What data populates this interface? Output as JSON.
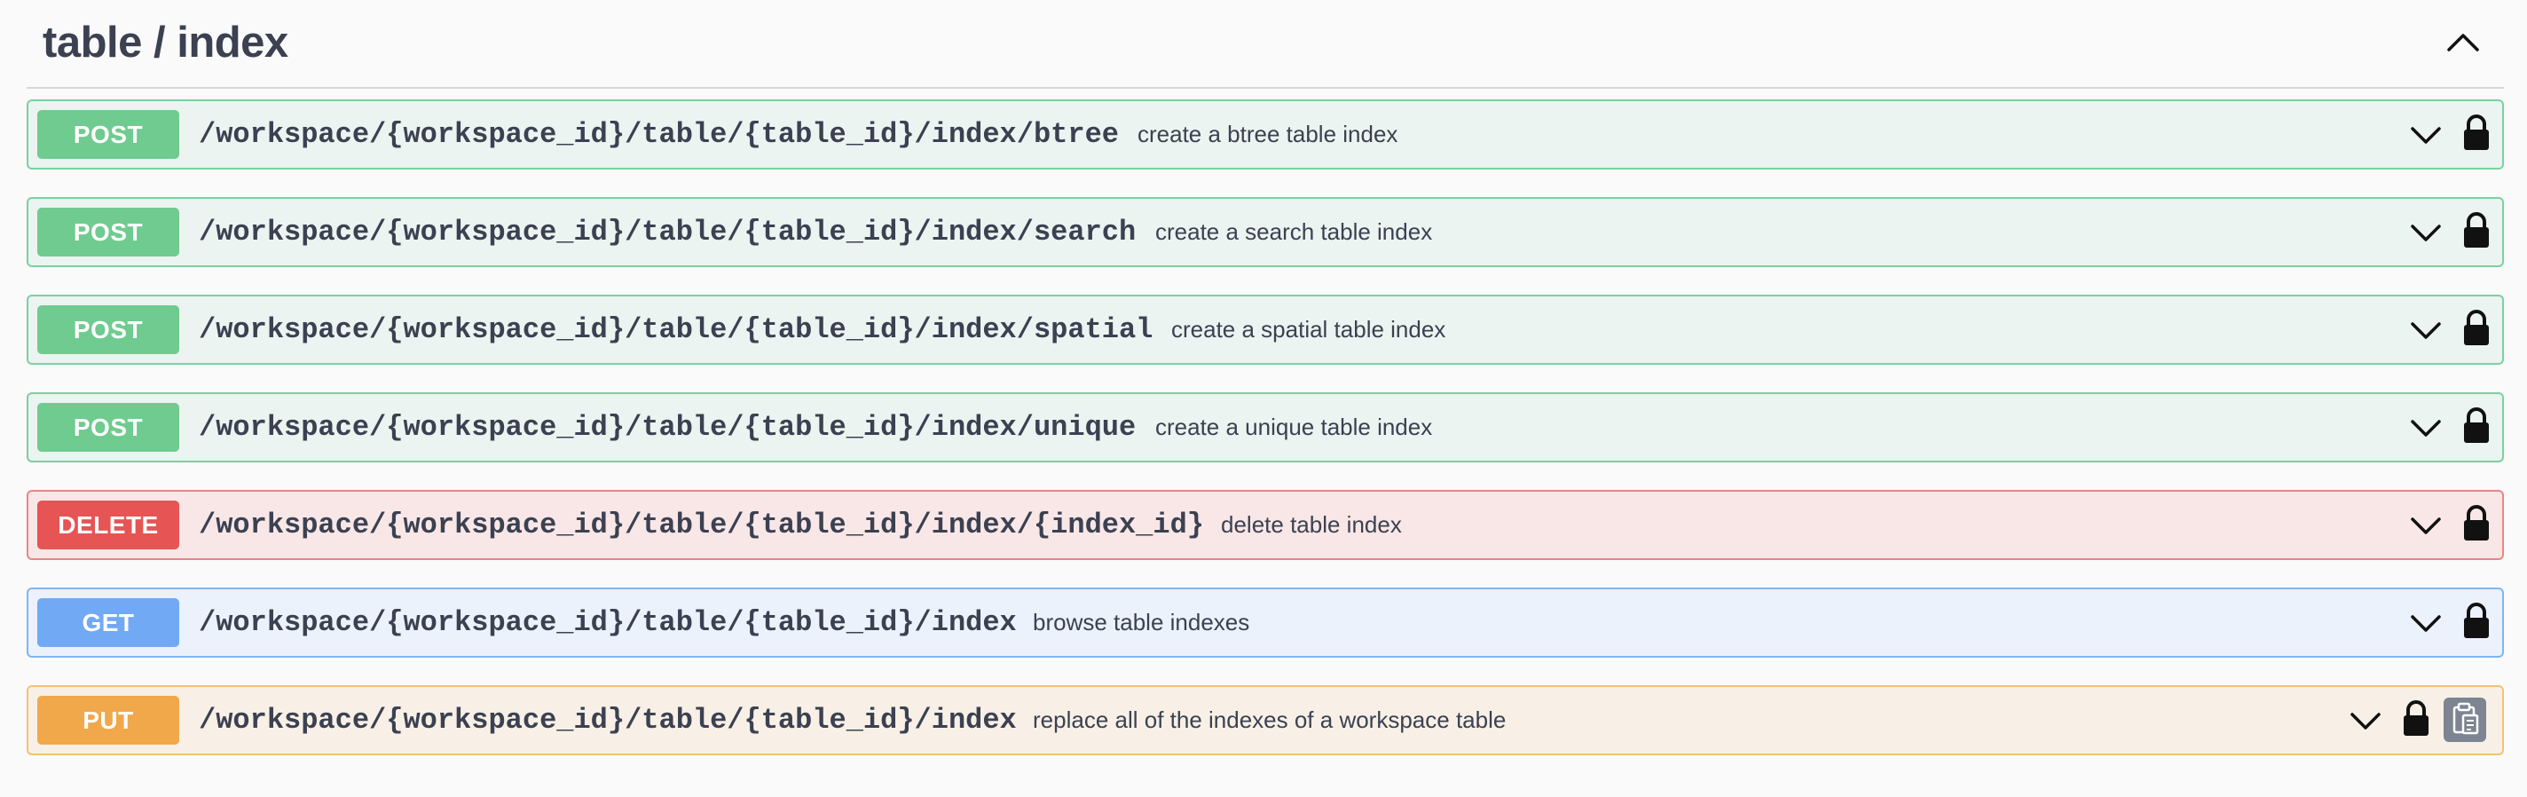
{
  "section": {
    "title": "table / index"
  },
  "operations": [
    {
      "method": "POST",
      "path": "/workspace/{workspace_id}/table/{table_id}/index/btree",
      "description": "create a btree table index"
    },
    {
      "method": "POST",
      "path": "/workspace/{workspace_id}/table/{table_id}/index/search",
      "description": "create a search table index"
    },
    {
      "method": "POST",
      "path": "/workspace/{workspace_id}/table/{table_id}/index/spatial",
      "description": "create a spatial table index"
    },
    {
      "method": "POST",
      "path": "/workspace/{workspace_id}/table/{table_id}/index/unique",
      "description": "create a unique table index"
    },
    {
      "method": "DELETE",
      "path": "/workspace/{workspace_id}/table/{table_id}/index/{index_id}",
      "description": "delete table index"
    },
    {
      "method": "GET",
      "path": "/workspace/{workspace_id}/table/{table_id}/index",
      "description": "browse table indexes"
    },
    {
      "method": "PUT",
      "path": "/workspace/{workspace_id}/table/{table_id}/index",
      "description": "replace all of the indexes of a workspace table"
    }
  ],
  "colors": {
    "post": "#6fcb8f",
    "delete": "#e65454",
    "get": "#71a9f4",
    "put": "#f0a84b",
    "text": "#3b4151"
  },
  "icons": {
    "collapse": "chevron-up-icon",
    "expand": "chevron-down-icon",
    "auth": "lock-icon",
    "copy": "clipboard-copy-icon"
  }
}
